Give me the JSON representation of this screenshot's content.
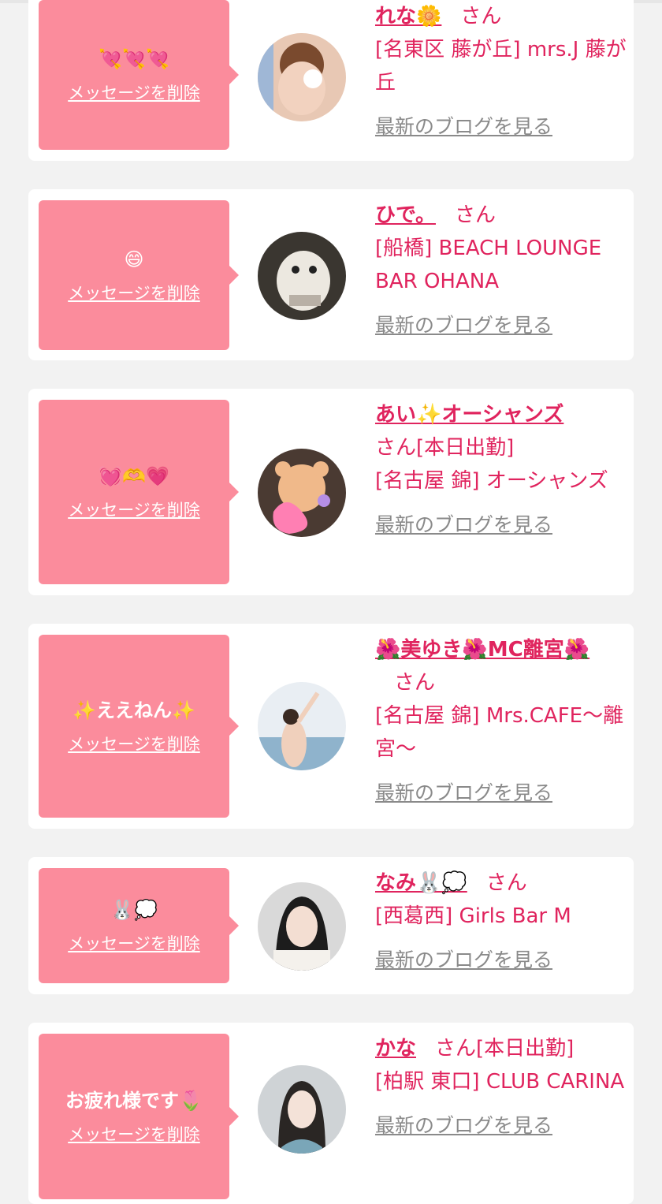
{
  "delete_label": "メッセージを削除",
  "blog_label": "最新のブログを見る",
  "san_label": "さん",
  "colors": {
    "bubble": "#fb8c9c",
    "accent": "#e0245e",
    "link_gray": "#8a8a8a",
    "background": "#f2f2f2"
  },
  "cards": [
    {
      "message": "💘💘💘",
      "name": "れな🌼",
      "status": "",
      "shop": "[名東区 藤が丘] mrs.J 藤が丘"
    },
    {
      "message": "😄",
      "name": "ひで。",
      "status": "",
      "shop": "[船橋] BEACH LOUNGE BAR OHANA"
    },
    {
      "message": "💓🫶💗",
      "name": "あい✨オーシャンズ",
      "status": "[本日出勤]",
      "shop": "[名古屋 錦] オーシャンズ"
    },
    {
      "message": "✨ええねん✨",
      "name": "🌺美ゆき🌺MC離宮🌺",
      "status": "",
      "shop": "[名古屋 錦] Mrs.CAFE〜離宮〜"
    },
    {
      "message": "🐰💭",
      "name": "なみ🐰💭",
      "status": "",
      "shop": "[西葛西] Girls Bar M"
    },
    {
      "message": "お疲れ様です🌷",
      "name": "かな",
      "status": "[本日出勤]",
      "shop": "[柏駅 東口] CLUB CARINA"
    }
  ]
}
